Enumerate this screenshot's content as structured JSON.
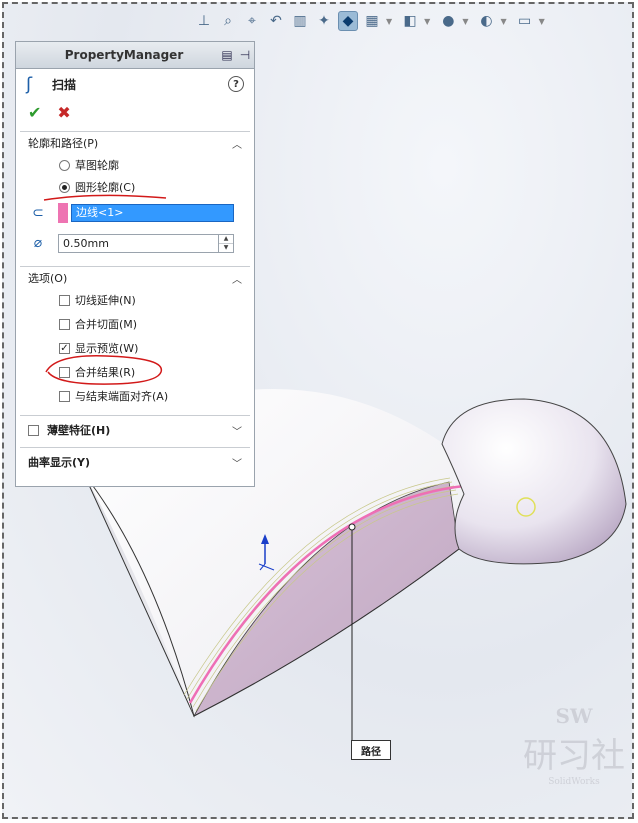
{
  "toolbar": {
    "icons": [
      "view-orientation-icon",
      "zoom-fit-icon",
      "zoom-area-icon",
      "previous-view-icon",
      "section-view-icon",
      "view-dynamic-icon",
      "display-style-icon",
      "hide-show-icon",
      "edit-appearance-icon",
      "apply-scene-icon",
      "view-settings-icon",
      "display-icon"
    ]
  },
  "pm": {
    "header_title": "PropertyManager",
    "feature_name": "扫描",
    "help": "?",
    "ok": "✔",
    "cancel": "✖",
    "profile_section": {
      "label": "轮廓和路径(P)",
      "radio_sketch": "草图轮廓",
      "radio_circle": "圆形轮廓(C)",
      "selection": "边线<1>",
      "diameter": "0.50mm"
    },
    "options_section": {
      "label": "选项(O)",
      "tangent_ext": "切线延伸(N)",
      "merge_faces": "合并切面(M)",
      "show_preview": "显示预览(W)",
      "merge_result": "合并结果(R)",
      "align_end": "与结束端面对齐(A)"
    },
    "thin_feature": "薄壁特征(H)",
    "curvature_display": "曲率显示(Y)"
  },
  "scene": {
    "callout": "路径"
  },
  "watermark": {
    "line1": "SW",
    "line2": "研习社",
    "line3": "SolidWorks"
  },
  "colors": {
    "selection": "#3399ff",
    "profile_swatch": "#ee74b2",
    "sweep_face": "#c8aec8",
    "path": "#ee6fb5"
  }
}
